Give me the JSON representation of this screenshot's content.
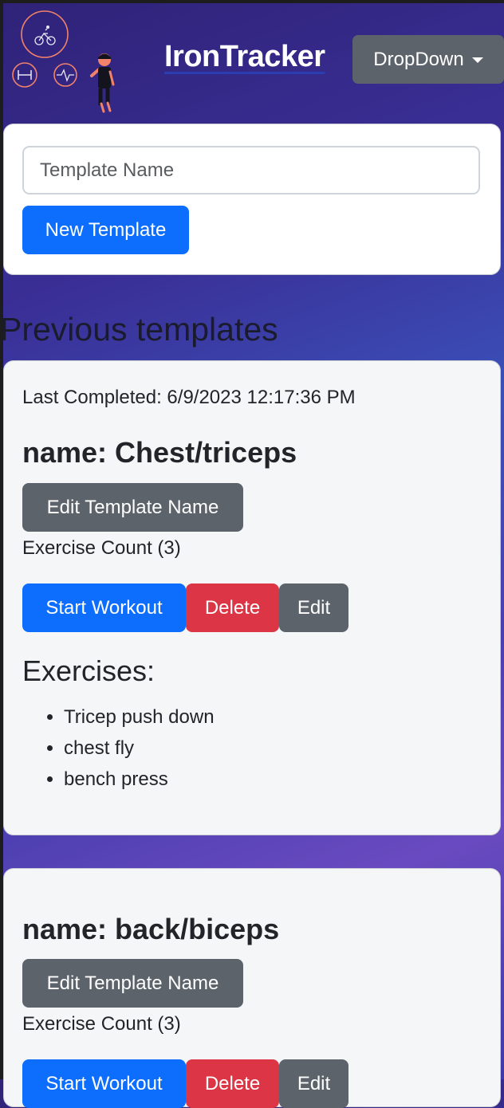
{
  "header": {
    "brand": "IronTracker",
    "dropdown_label": "DropDown"
  },
  "new_template": {
    "input_placeholder": "Template Name",
    "input_value": "",
    "button_label": "New Template"
  },
  "section_title": "Previous templates",
  "templates": [
    {
      "last_completed": "Last Completed: 6/9/2023 12:17:36 PM",
      "name": "name: Chest/triceps",
      "edit_name_label": "Edit Template Name",
      "exercise_count": "Exercise Count (3)",
      "start_label": "Start Workout",
      "delete_label": "Delete",
      "edit_label": "Edit",
      "exercises_title": "Exercises:",
      "exercises": [
        "Tricep push down",
        "chest fly",
        "bench press"
      ]
    },
    {
      "last_completed": "",
      "name": "name: back/biceps",
      "edit_name_label": "Edit Template Name",
      "exercise_count": "Exercise Count (3)",
      "start_label": "Start Workout",
      "delete_label": "Delete",
      "edit_label": "Edit"
    }
  ],
  "colors": {
    "primary": "#0d6efd",
    "danger": "#dc3545",
    "secondary": "#5c636a",
    "logo_accent": "#f2826a"
  },
  "icons": [
    "bicycle-icon",
    "dumbbell-icon",
    "heartbeat-icon",
    "runner-figure-icon"
  ]
}
